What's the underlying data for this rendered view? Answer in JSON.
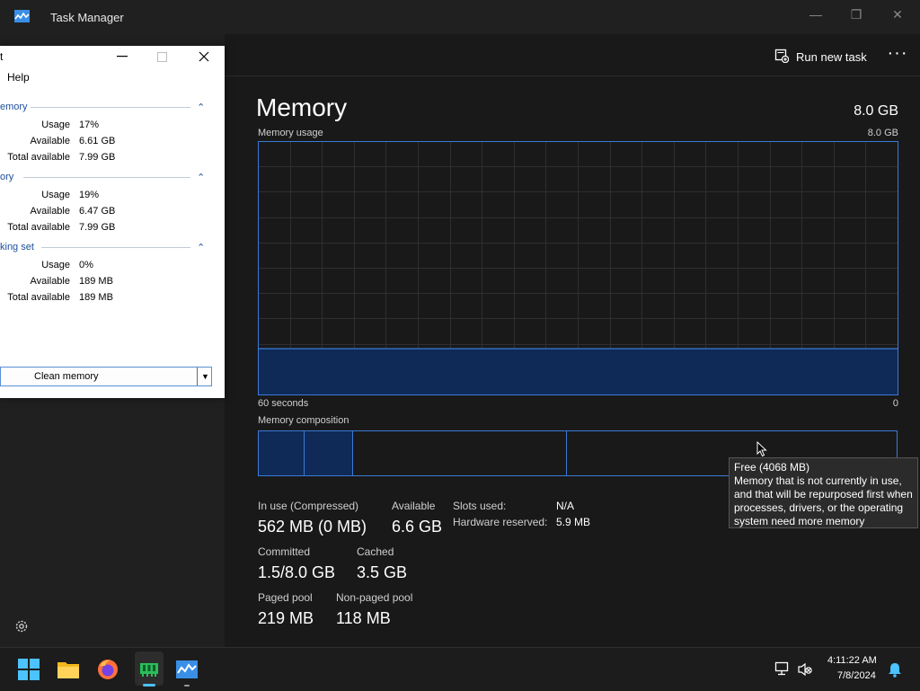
{
  "window": {
    "title": "Task Manager",
    "minimize_glyph": "—",
    "restore_glyph": "❐",
    "close_glyph": "✕"
  },
  "commandbar": {
    "run_new_task": "Run new task",
    "more_glyph": "···"
  },
  "memory": {
    "title": "Memory",
    "total": "8.0 GB",
    "usage_label": "Memory usage",
    "usage_max": "8.0 GB",
    "axis_left": "60 seconds",
    "axis_right": "0",
    "usage_fraction": 0.18,
    "composition_label": "Memory composition",
    "composition_segments_mb": [
      562,
      600,
      2650,
      4068
    ],
    "stats": {
      "in_use_label": "In use (Compressed)",
      "in_use_value": "562 MB (0 MB)",
      "available_label": "Available",
      "available_value": "6.6 GB",
      "committed_label": "Committed",
      "committed_value": "1.5/8.0 GB",
      "cached_label": "Cached",
      "cached_value": "3.5 GB",
      "paged_label": "Paged pool",
      "paged_value": "219 MB",
      "nonpaged_label": "Non-paged pool",
      "nonpaged_value": "118 MB",
      "slots_label": "Slots used:",
      "slots_value": "N/A",
      "hw_label": "Hardware reserved:",
      "hw_value": "5.9 MB"
    },
    "tooltip": {
      "title": "Free (4068 MB)",
      "line1": "Memory that is not currently in use,",
      "line2": "and that will be repurposed first when",
      "line3": "processes, drivers, or the operating",
      "line4": "system need more memory"
    }
  },
  "cleaner": {
    "title_fragment": "t",
    "menu_help": "Help",
    "sections": [
      {
        "title": "emory",
        "usage_label": "Usage",
        "usage": "17%",
        "avail_label": "Available",
        "avail": "6.61 GB",
        "total_label": "Total available",
        "total": "7.99 GB"
      },
      {
        "title": "ory",
        "usage_label": "Usage",
        "usage": "19%",
        "avail_label": "Available",
        "avail": "6.47 GB",
        "total_label": "Total available",
        "total": "7.99 GB"
      },
      {
        "title": "king set",
        "usage_label": "Usage",
        "usage": "0%",
        "avail_label": "Available",
        "avail": "189 MB",
        "total_label": "Total available",
        "total": "189 MB"
      }
    ],
    "chevron_glyph": "⌃",
    "clean_button": "Clean memory",
    "dropdown_glyph": "▼"
  },
  "taskbar": {
    "time": "4:11:22 AM",
    "date": "7/8/2024"
  },
  "colors": {
    "accent_blue": "#3b7ad6",
    "graph_fill": "#0f2a57",
    "taskbar_indicator": "#4cc2ff"
  }
}
